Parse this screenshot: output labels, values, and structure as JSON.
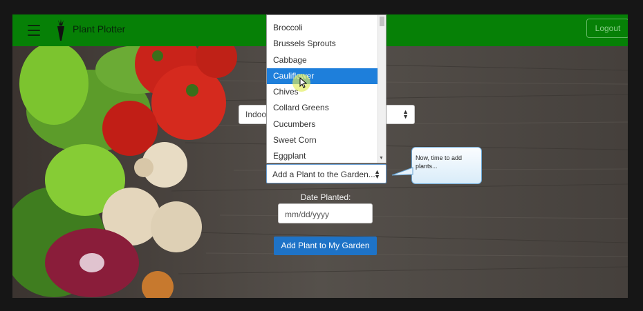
{
  "navbar": {
    "brand": "Plant Plotter",
    "logout_label": "Logout",
    "menu_icon": "hamburger-icon",
    "logo_icon": "carrot-icon",
    "color": "#068006"
  },
  "form": {
    "location_value": "Indoor",
    "plant_select_value": "Add a Plant to the Garden...",
    "date_label": "Date Planted:",
    "date_placeholder": "mm/dd/yyyy",
    "submit_label": "Add Plant to My Garden"
  },
  "dropdown": {
    "options": [
      "Broccoli",
      "Brussels Sprouts",
      "Cabbage",
      "Cauliflower",
      "Chives",
      "Collard Greens",
      "Cucumbers",
      "Sweet Corn",
      "Eggplant"
    ],
    "selected": "Cauliflower",
    "highlight_color": "#1e7fdb"
  },
  "tooltip": {
    "text": "Now, time to add plants..."
  }
}
